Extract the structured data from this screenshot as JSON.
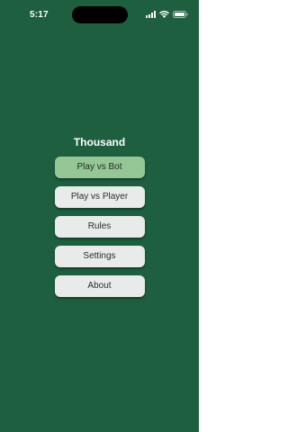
{
  "status_bar": {
    "time": "5:17",
    "icons": [
      "signal-icon",
      "wifi-icon",
      "battery-icon"
    ]
  },
  "menu": {
    "title": "Thousand",
    "buttons": [
      {
        "label": "Play vs Bot",
        "highlighted": true
      },
      {
        "label": "Play vs Player",
        "highlighted": false
      },
      {
        "label": "Rules",
        "highlighted": false
      },
      {
        "label": "Settings",
        "highlighted": false
      },
      {
        "label": "About",
        "highlighted": false
      }
    ]
  },
  "colors": {
    "background": "#1e5f3f",
    "button": "#e8ebe9",
    "button_highlighted": "#95c796",
    "title_text": "#ffffff"
  }
}
